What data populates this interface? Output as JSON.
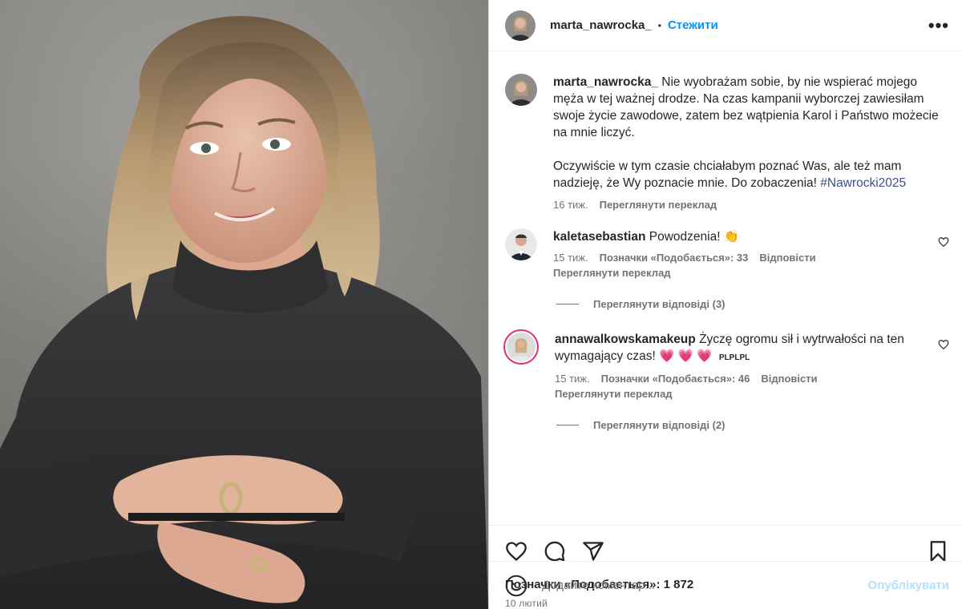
{
  "post": {
    "author": "marta_nawrocka_",
    "follow_label": "Стежити",
    "dot": "•",
    "more_label": "•••"
  },
  "caption": {
    "author": "marta_nawrocka_",
    "paragraph1": "Nie wyobrażam sobie, by nie wspierać mojego męża w tej ważnej drodze. Na czas kampanii wyborczej zawiesiłam swoje życie zawodowe, zatem bez wątpienia Karol i Państwo możecie na mnie liczyć.",
    "paragraph2": "Oczywiście w tym czasie chciałabym poznać Was, ale też mam nadzieję, że Wy poznacie mnie. Do zobaczenia!",
    "hashtag": "#Nawrocki2025",
    "time": "16 тиж.",
    "translate": "Переглянути переклад"
  },
  "comments": [
    {
      "user": "kaletasebastian",
      "text": "Powodzenia!",
      "emoji": "👏",
      "time": "15 тиж.",
      "likes": "Позначки «Подобається»: 33",
      "reply": "Відповісти",
      "translate": "Переглянути переклад",
      "view_replies": "Переглянути відповіді (3)"
    },
    {
      "user": "annawalkowskamakeup",
      "text": "Życzę ogromu sił i wytrwałości na ten wymagający czas!",
      "emoji": "💗 💗 💗",
      "flag": "PLPLPL",
      "time": "15 тиж.",
      "likes": "Позначки «Подобається»: 46",
      "reply": "Відповісти",
      "translate": "Переглянути переклад",
      "view_replies": "Переглянути відповіді (2)"
    }
  ],
  "footer": {
    "likes": "Позначки «Подобається»: 1 872",
    "date": "10 лютий",
    "comment_placeholder": "Додайте коментар...",
    "publish_label": "Опублікувати"
  },
  "icons": [
    "heart-icon",
    "comment-icon",
    "share-icon",
    "bookmark-icon",
    "smile-icon",
    "more-icon"
  ],
  "colors": {
    "follow": "#0095f6",
    "publish_disabled": "#b2dffc",
    "hashtag": "#385185"
  }
}
